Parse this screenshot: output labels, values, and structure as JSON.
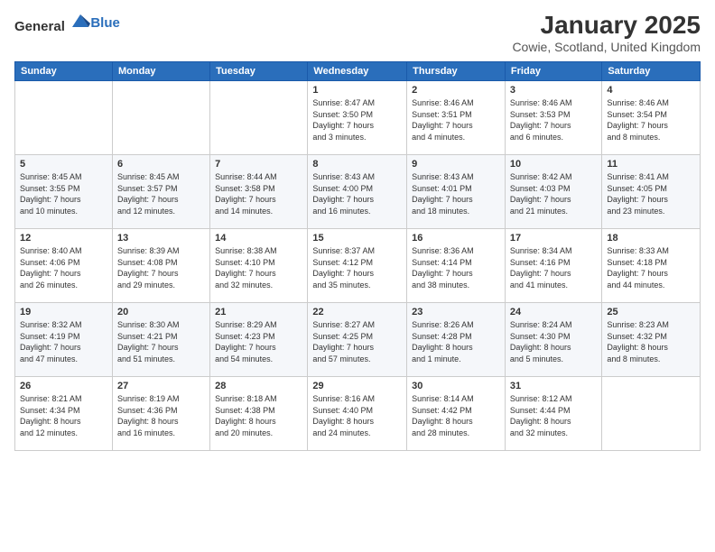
{
  "header": {
    "logo_general": "General",
    "logo_blue": "Blue",
    "month": "January 2025",
    "location": "Cowie, Scotland, United Kingdom"
  },
  "days_of_week": [
    "Sunday",
    "Monday",
    "Tuesday",
    "Wednesday",
    "Thursday",
    "Friday",
    "Saturday"
  ],
  "weeks": [
    [
      {
        "day": "",
        "info": ""
      },
      {
        "day": "",
        "info": ""
      },
      {
        "day": "",
        "info": ""
      },
      {
        "day": "1",
        "info": "Sunrise: 8:47 AM\nSunset: 3:50 PM\nDaylight: 7 hours\nand 3 minutes."
      },
      {
        "day": "2",
        "info": "Sunrise: 8:46 AM\nSunset: 3:51 PM\nDaylight: 7 hours\nand 4 minutes."
      },
      {
        "day": "3",
        "info": "Sunrise: 8:46 AM\nSunset: 3:53 PM\nDaylight: 7 hours\nand 6 minutes."
      },
      {
        "day": "4",
        "info": "Sunrise: 8:46 AM\nSunset: 3:54 PM\nDaylight: 7 hours\nand 8 minutes."
      }
    ],
    [
      {
        "day": "5",
        "info": "Sunrise: 8:45 AM\nSunset: 3:55 PM\nDaylight: 7 hours\nand 10 minutes."
      },
      {
        "day": "6",
        "info": "Sunrise: 8:45 AM\nSunset: 3:57 PM\nDaylight: 7 hours\nand 12 minutes."
      },
      {
        "day": "7",
        "info": "Sunrise: 8:44 AM\nSunset: 3:58 PM\nDaylight: 7 hours\nand 14 minutes."
      },
      {
        "day": "8",
        "info": "Sunrise: 8:43 AM\nSunset: 4:00 PM\nDaylight: 7 hours\nand 16 minutes."
      },
      {
        "day": "9",
        "info": "Sunrise: 8:43 AM\nSunset: 4:01 PM\nDaylight: 7 hours\nand 18 minutes."
      },
      {
        "day": "10",
        "info": "Sunrise: 8:42 AM\nSunset: 4:03 PM\nDaylight: 7 hours\nand 21 minutes."
      },
      {
        "day": "11",
        "info": "Sunrise: 8:41 AM\nSunset: 4:05 PM\nDaylight: 7 hours\nand 23 minutes."
      }
    ],
    [
      {
        "day": "12",
        "info": "Sunrise: 8:40 AM\nSunset: 4:06 PM\nDaylight: 7 hours\nand 26 minutes."
      },
      {
        "day": "13",
        "info": "Sunrise: 8:39 AM\nSunset: 4:08 PM\nDaylight: 7 hours\nand 29 minutes."
      },
      {
        "day": "14",
        "info": "Sunrise: 8:38 AM\nSunset: 4:10 PM\nDaylight: 7 hours\nand 32 minutes."
      },
      {
        "day": "15",
        "info": "Sunrise: 8:37 AM\nSunset: 4:12 PM\nDaylight: 7 hours\nand 35 minutes."
      },
      {
        "day": "16",
        "info": "Sunrise: 8:36 AM\nSunset: 4:14 PM\nDaylight: 7 hours\nand 38 minutes."
      },
      {
        "day": "17",
        "info": "Sunrise: 8:34 AM\nSunset: 4:16 PM\nDaylight: 7 hours\nand 41 minutes."
      },
      {
        "day": "18",
        "info": "Sunrise: 8:33 AM\nSunset: 4:18 PM\nDaylight: 7 hours\nand 44 minutes."
      }
    ],
    [
      {
        "day": "19",
        "info": "Sunrise: 8:32 AM\nSunset: 4:19 PM\nDaylight: 7 hours\nand 47 minutes."
      },
      {
        "day": "20",
        "info": "Sunrise: 8:30 AM\nSunset: 4:21 PM\nDaylight: 7 hours\nand 51 minutes."
      },
      {
        "day": "21",
        "info": "Sunrise: 8:29 AM\nSunset: 4:23 PM\nDaylight: 7 hours\nand 54 minutes."
      },
      {
        "day": "22",
        "info": "Sunrise: 8:27 AM\nSunset: 4:25 PM\nDaylight: 7 hours\nand 57 minutes."
      },
      {
        "day": "23",
        "info": "Sunrise: 8:26 AM\nSunset: 4:28 PM\nDaylight: 8 hours\nand 1 minute."
      },
      {
        "day": "24",
        "info": "Sunrise: 8:24 AM\nSunset: 4:30 PM\nDaylight: 8 hours\nand 5 minutes."
      },
      {
        "day": "25",
        "info": "Sunrise: 8:23 AM\nSunset: 4:32 PM\nDaylight: 8 hours\nand 8 minutes."
      }
    ],
    [
      {
        "day": "26",
        "info": "Sunrise: 8:21 AM\nSunset: 4:34 PM\nDaylight: 8 hours\nand 12 minutes."
      },
      {
        "day": "27",
        "info": "Sunrise: 8:19 AM\nSunset: 4:36 PM\nDaylight: 8 hours\nand 16 minutes."
      },
      {
        "day": "28",
        "info": "Sunrise: 8:18 AM\nSunset: 4:38 PM\nDaylight: 8 hours\nand 20 minutes."
      },
      {
        "day": "29",
        "info": "Sunrise: 8:16 AM\nSunset: 4:40 PM\nDaylight: 8 hours\nand 24 minutes."
      },
      {
        "day": "30",
        "info": "Sunrise: 8:14 AM\nSunset: 4:42 PM\nDaylight: 8 hours\nand 28 minutes."
      },
      {
        "day": "31",
        "info": "Sunrise: 8:12 AM\nSunset: 4:44 PM\nDaylight: 8 hours\nand 32 minutes."
      },
      {
        "day": "",
        "info": ""
      }
    ]
  ]
}
